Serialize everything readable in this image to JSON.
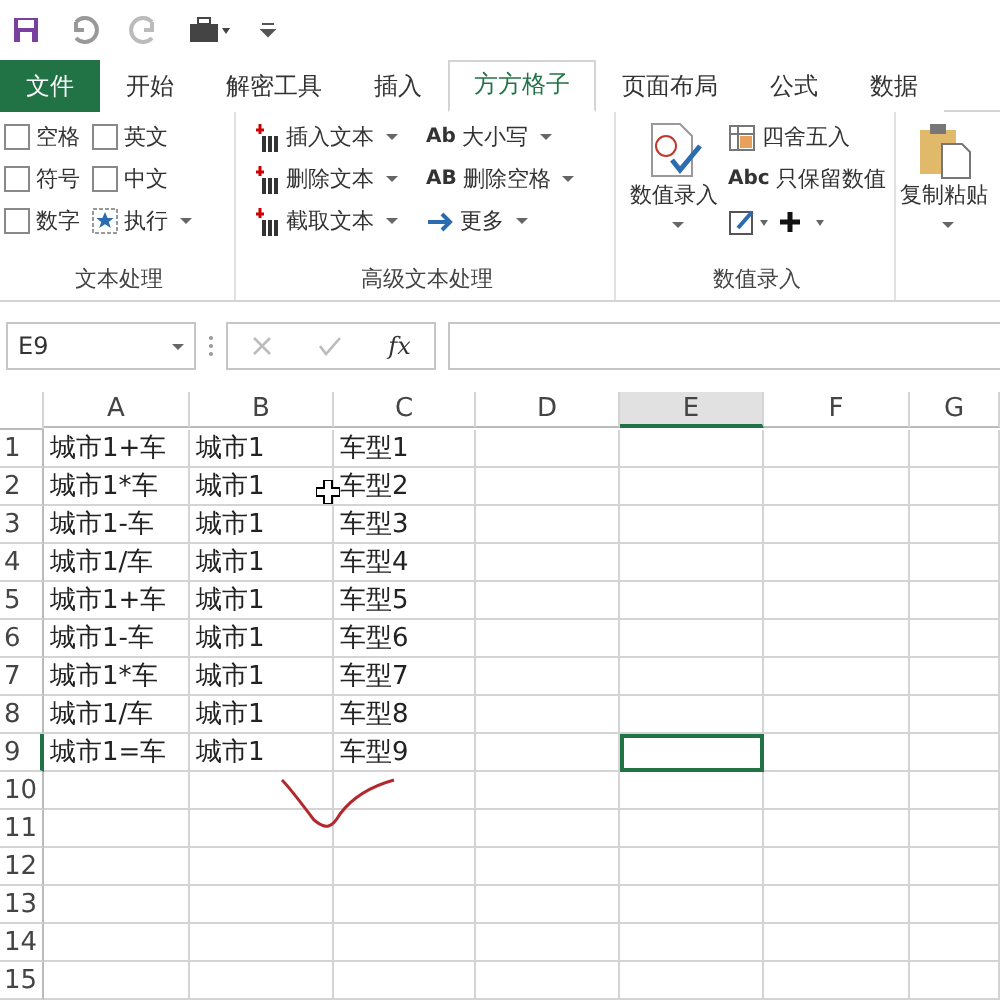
{
  "tabs": [
    {
      "label": "文件",
      "kind": "file",
      "selected": false
    },
    {
      "label": "开始",
      "kind": "tab",
      "selected": false
    },
    {
      "label": "解密工具",
      "kind": "tab",
      "selected": false
    },
    {
      "label": "插入",
      "kind": "tab",
      "selected": false
    },
    {
      "label": "方方格子",
      "kind": "tab",
      "selected": true
    },
    {
      "label": "页面布局",
      "kind": "tab",
      "selected": false
    },
    {
      "label": "公式",
      "kind": "tab",
      "selected": false
    },
    {
      "label": "数据",
      "kind": "tab",
      "selected": false
    }
  ],
  "ribbon": {
    "text_group": {
      "title": "文本处理",
      "checkboxes": [
        {
          "label": "空格",
          "checked": false
        },
        {
          "label": "英文",
          "checked": false
        },
        {
          "label": "符号",
          "checked": false
        },
        {
          "label": "中文",
          "checked": false
        },
        {
          "label": "数字",
          "checked": false
        }
      ],
      "run_button": "执行"
    },
    "advanced_group": {
      "title": "高级文本处理",
      "buttons": [
        {
          "label": "插入文本",
          "kind": "bars"
        },
        {
          "label": "删除文本",
          "kind": "bars"
        },
        {
          "label": "截取文本",
          "kind": "bars"
        },
        {
          "label": "大小写",
          "kind": "letters",
          "icon_text": "Ab"
        },
        {
          "label": "删除空格",
          "kind": "letters",
          "icon_text": "AB"
        },
        {
          "label": "更多",
          "kind": "arrow"
        }
      ]
    },
    "number_group": {
      "title": "数值录入",
      "big_button": "数值录入",
      "round_button": "四舍五入",
      "keep_button": "只保留数值",
      "keep_icon_text": "Abc"
    },
    "paste_button": "复制粘贴"
  },
  "formula_bar": {
    "name_box": "E9",
    "fx_label": "fx"
  },
  "grid": {
    "columns": [
      {
        "label": "A",
        "selected": false
      },
      {
        "label": "B",
        "selected": false
      },
      {
        "label": "C",
        "selected": false
      },
      {
        "label": "D",
        "selected": false
      },
      {
        "label": "E",
        "selected": true
      },
      {
        "label": "F",
        "selected": false
      },
      {
        "label": "G",
        "selected": false
      }
    ],
    "rows": [
      {
        "label": "1",
        "selected": false,
        "cells": [
          "城市1+车",
          "城市1",
          "车型1"
        ]
      },
      {
        "label": "2",
        "selected": false,
        "cells": [
          "城市1*车",
          "城市1",
          "车型2"
        ]
      },
      {
        "label": "3",
        "selected": false,
        "cells": [
          "城市1-车",
          "城市1",
          "车型3"
        ]
      },
      {
        "label": "4",
        "selected": false,
        "cells": [
          "城市1/车",
          "城市1",
          "车型4"
        ]
      },
      {
        "label": "5",
        "selected": false,
        "cells": [
          "城市1+车",
          "城市1",
          "车型5"
        ]
      },
      {
        "label": "6",
        "selected": false,
        "cells": [
          "城市1-车",
          "城市1",
          "车型6"
        ]
      },
      {
        "label": "7",
        "selected": false,
        "cells": [
          "城市1*车",
          "城市1",
          "车型7"
        ]
      },
      {
        "label": "8",
        "selected": false,
        "cells": [
          "城市1/车",
          "城市1",
          "车型8"
        ]
      },
      {
        "label": "9",
        "selected": true,
        "cells": [
          "城市1=车",
          "城市1",
          "车型9"
        ]
      },
      {
        "label": "10",
        "selected": false,
        "cells": []
      },
      {
        "label": "11",
        "selected": false,
        "cells": []
      },
      {
        "label": "12",
        "selected": false,
        "cells": []
      },
      {
        "label": "13",
        "selected": false,
        "cells": []
      },
      {
        "label": "14",
        "selected": false,
        "cells": []
      },
      {
        "label": "15",
        "selected": false,
        "cells": []
      }
    ]
  }
}
